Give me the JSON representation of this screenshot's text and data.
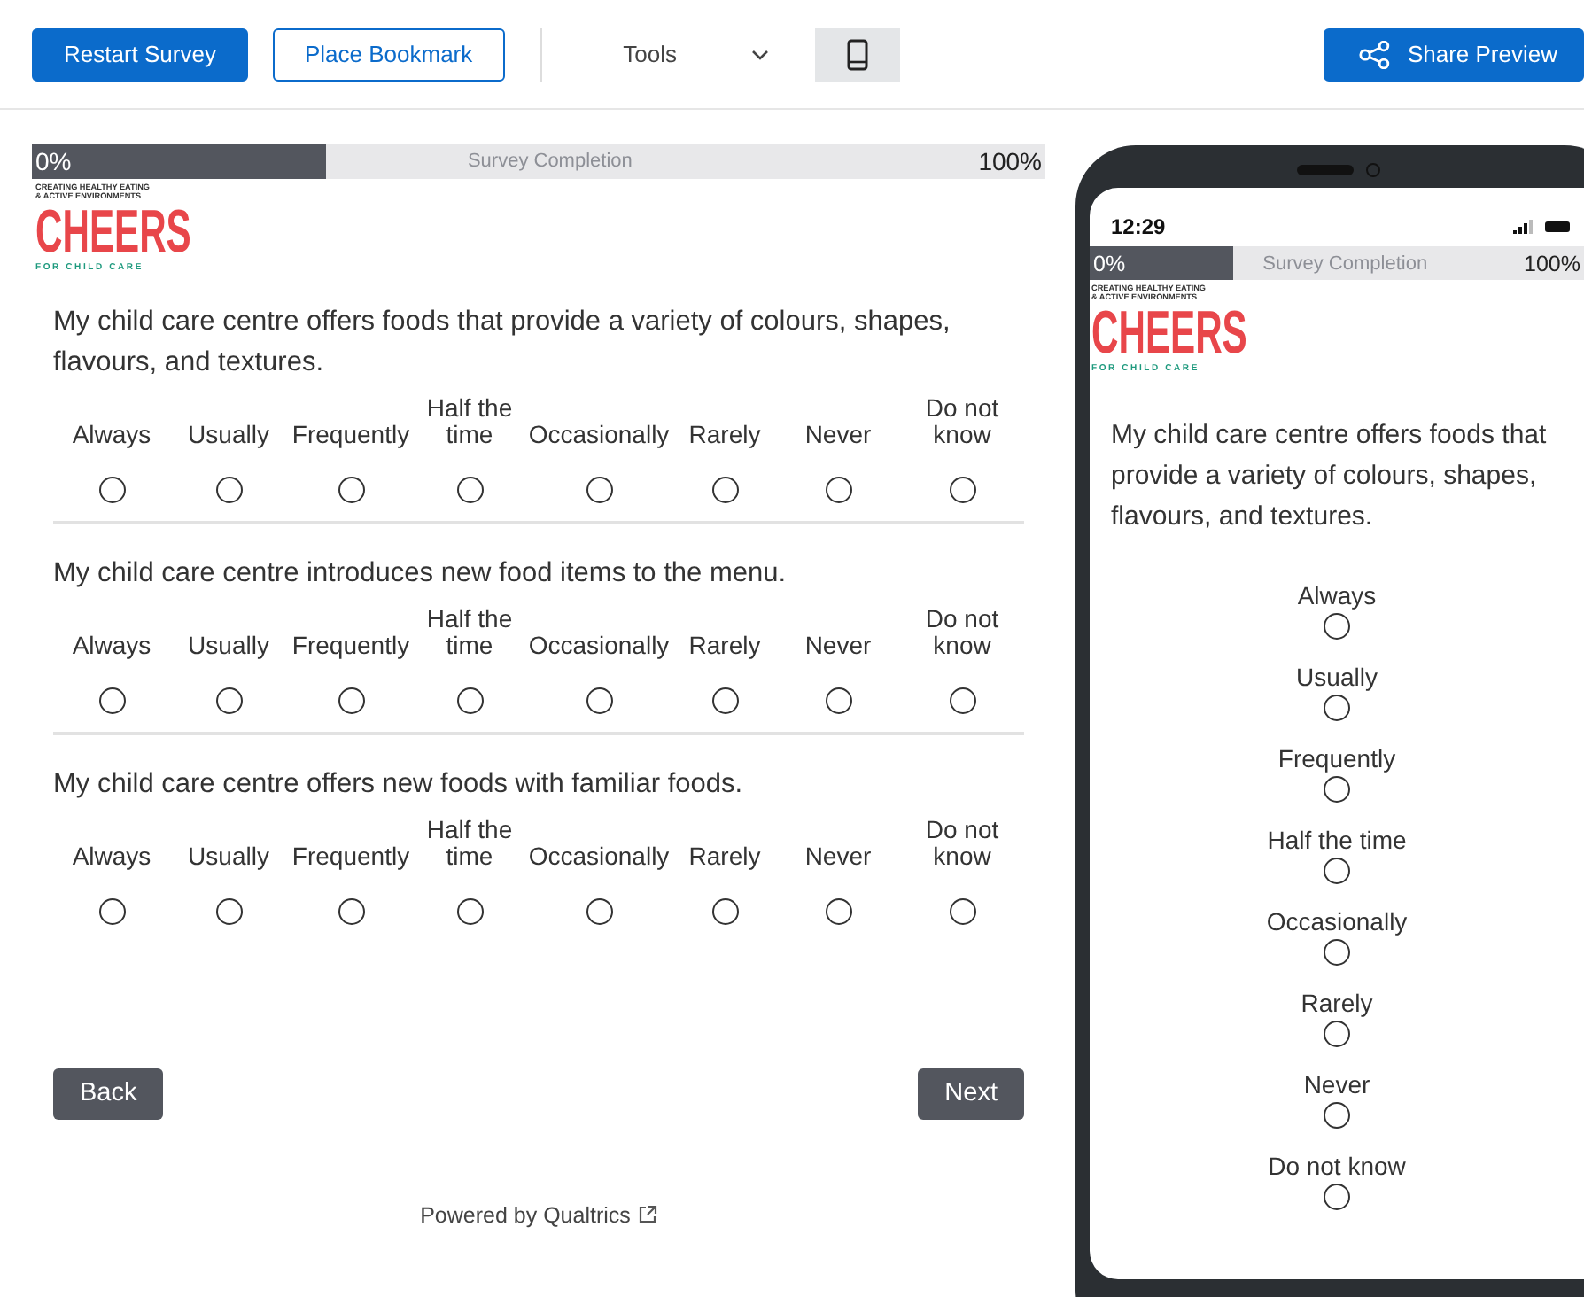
{
  "toolbar": {
    "restart": "Restart Survey",
    "bookmark": "Place Bookmark",
    "tools": "Tools",
    "device_button": {
      "selected": true
    },
    "share": "Share Preview"
  },
  "progress": {
    "start": "0%",
    "title": "Survey Completion",
    "end": "100%",
    "level": 0.29
  },
  "logo": {
    "tagline_1": "CREATING HEALTHY EATING",
    "tagline_2": "& ACTIVE ENVIRONMENTS",
    "wordmark": "CHEERS",
    "subline": "FOR CHILD CARE"
  },
  "questions": [
    {
      "text": "My child care centre offers foods that provide a variety of colours, shapes, flavours, and textures.",
      "options": [
        {
          "label": "Always",
          "selected": false
        },
        {
          "label": "Usually",
          "selected": false
        },
        {
          "label": "Frequently",
          "selected": false
        },
        {
          "label": "Half the time",
          "selected": false
        },
        {
          "label": "Occasionally",
          "selected": false
        },
        {
          "label": "Rarely",
          "selected": false
        },
        {
          "label": "Never",
          "selected": false
        },
        {
          "label": "Do not know",
          "selected": false
        }
      ]
    },
    {
      "text": "My child care centre introduces new food items to the menu.",
      "options": [
        {
          "label": "Always",
          "selected": false
        },
        {
          "label": "Usually",
          "selected": false
        },
        {
          "label": "Frequently",
          "selected": false
        },
        {
          "label": "Half the time",
          "selected": false
        },
        {
          "label": "Occasionally",
          "selected": false
        },
        {
          "label": "Rarely",
          "selected": false
        },
        {
          "label": "Never",
          "selected": false
        },
        {
          "label": "Do not know",
          "selected": false
        }
      ]
    },
    {
      "text": "My child care centre offers new foods with familiar foods.",
      "options": [
        {
          "label": "Always",
          "selected": false
        },
        {
          "label": "Usually",
          "selected": false
        },
        {
          "label": "Frequently",
          "selected": false
        },
        {
          "label": "Half the time",
          "selected": false
        },
        {
          "label": "Occasionally",
          "selected": false
        },
        {
          "label": "Rarely",
          "selected": false
        },
        {
          "label": "Never",
          "selected": false
        },
        {
          "label": "Do not know",
          "selected": false
        }
      ]
    }
  ],
  "navigation": {
    "back": "Back",
    "next": "Next"
  },
  "footer": "Powered by Qualtrics",
  "preview": {
    "time": "12:29",
    "progress": {
      "start": "0%",
      "title": "Survey Completion",
      "end": "100%",
      "level": 0.29
    },
    "logo": {
      "tagline_1": "CREATING HEALTHY EATING",
      "tagline_2": "& ACTIVE ENVIRONMENTS",
      "wordmark": "CHEERS",
      "subline": "FOR CHILD CARE"
    },
    "question": {
      "text": "My child care centre offers foods that provide a variety of colours, shapes, flavours, and textures.",
      "options": [
        {
          "label": "Always",
          "selected": false
        },
        {
          "label": "Usually",
          "selected": false
        },
        {
          "label": "Frequently",
          "selected": false
        },
        {
          "label": "Half the time",
          "selected": false
        },
        {
          "label": "Occasionally",
          "selected": false
        },
        {
          "label": "Rarely",
          "selected": false
        },
        {
          "label": "Never",
          "selected": false
        },
        {
          "label": "Do not know",
          "selected": false
        }
      ]
    }
  }
}
